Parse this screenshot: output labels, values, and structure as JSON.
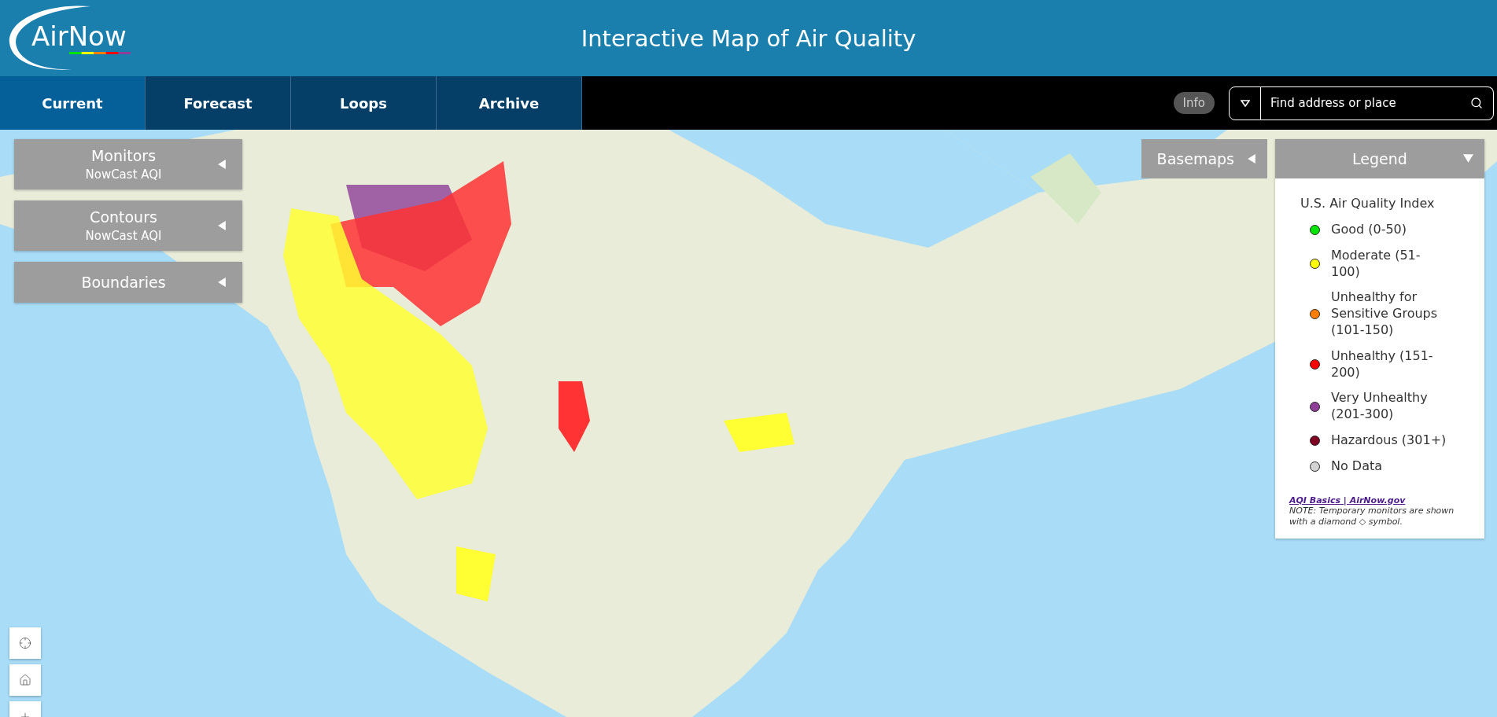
{
  "header": {
    "logo": "AirNow",
    "title": "Interactive Map of Air Quality"
  },
  "tabs": [
    {
      "label": "Current",
      "selected": true
    },
    {
      "label": "Forecast",
      "selected": false
    },
    {
      "label": "Loops",
      "selected": false
    },
    {
      "label": "Archive",
      "selected": false
    }
  ],
  "info_button": "Info",
  "search": {
    "placeholder": "Find address or place"
  },
  "layer_panels": [
    {
      "title": "Monitors",
      "subtitle": "NowCast AQI",
      "expanded": false
    },
    {
      "title": "Contours",
      "subtitle": "NowCast AQI",
      "expanded": false
    },
    {
      "title": "Boundaries",
      "expanded": false
    }
  ],
  "basemaps": {
    "title": "Basemaps",
    "expanded": false
  },
  "legend": {
    "title": "Legend",
    "expanded": true,
    "heading": "U.S. Air Quality Index",
    "items": [
      {
        "label": "Good (0-50)",
        "color": "#00e400"
      },
      {
        "label": "Moderate (51-100)",
        "color": "#ffff00"
      },
      {
        "label": "Unhealthy for Sensitive Groups (101-150)",
        "color": "#ff7e00"
      },
      {
        "label": "Unhealthy (151-200)",
        "color": "#ff0000"
      },
      {
        "label": "Very Unhealthy (201-300)",
        "color": "#8f3f97"
      },
      {
        "label": "Hazardous (301+)",
        "color": "#7e0023"
      },
      {
        "label": "No Data",
        "color": "#d3d3d3"
      }
    ],
    "link": "AQI Basics | AirNow.gov",
    "note": "NOTE: Temporary monitors are shown with a diamond ◇ symbol."
  }
}
